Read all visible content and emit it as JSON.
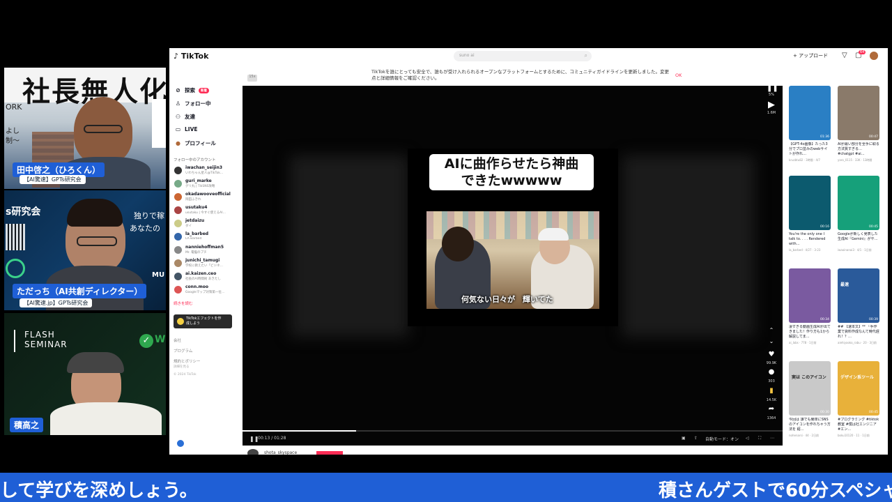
{
  "participants": [
    {
      "name": "田中啓之（ひろくん）",
      "org": "【AI驚速】GPTs研究会",
      "bg_text_big": "社長無人化",
      "bg_text_small_1": "ORK",
      "bg_text_small_2": "よし",
      "bg_text_small_3": "制〜"
    },
    {
      "name": "ただっち（AI共創ディレクター）",
      "org": "【AI驚速.jp】GPTs研究会",
      "bg_text_1": "s研究会",
      "bg_text_2": "独りで稼",
      "bg_text_3": "あなたの",
      "bg_text_4": "MU"
    },
    {
      "name": "積高之",
      "seminar_line1": "FLASH",
      "seminar_line2": "SEMINAR"
    }
  ],
  "tiktok": {
    "logo": "TikTok",
    "search_placeholder": "suno ai",
    "upload_label": "+ アップロード",
    "inbox_badge": "64",
    "notice": "TikTokを誰にとっても安全で、誰もが受け入れられるオープンなプラットフォームとするために、コミュニティガイドラインを更新しました。変更点と詳細情報をご確認ください。",
    "notice_ok": "OK",
    "back_chip": "15x",
    "nav": [
      {
        "label": "探索",
        "badge": "新着",
        "icon": "compass-icon",
        "glyph": "⊘"
      },
      {
        "label": "フォロー中",
        "icon": "follow-icon",
        "glyph": "♙"
      },
      {
        "label": "友達",
        "icon": "friends-icon",
        "glyph": "⚇"
      },
      {
        "label": "LIVE",
        "icon": "live-icon",
        "glyph": "▭"
      },
      {
        "label": "プロフィール",
        "icon": "profile-icon",
        "glyph": "●"
      }
    ],
    "following_title": "フォロー中のアカウント",
    "accounts": [
      {
        "name": "iwachan_seijin3",
        "sub": "いわちゃん星人@TikTok…",
        "color": "#333"
      },
      {
        "name": "guri_marke",
        "sub": "グリ丸 | TikSNS攻略",
        "color": "#7a8"
      },
      {
        "name": "okadawooveofficial",
        "sub": "岡田ふきれ",
        "color": "#c63"
      },
      {
        "name": "usutaku4",
        "sub": "usutaku | 今すぐ使えるAI…",
        "color": "#a44"
      },
      {
        "name": "jetdaizu",
        "sub": "ダイ",
        "color": "#cc8"
      },
      {
        "name": "la_barbed",
        "sub": "LA Barbed",
        "color": "#36a"
      },
      {
        "name": "nanniehoffman5",
        "sub": "Mr. 電脳のプチ",
        "color": "#888"
      },
      {
        "name": "junichi_tamugi",
        "sub": "学校に教えたい「ビジネ…",
        "color": "#a86"
      },
      {
        "name": "ai.kaizen.ceo",
        "sub": "社長のAI時間術 あきたし",
        "color": "#456"
      },
      {
        "name": "conn.moo",
        "sub": "Googleマップ対策第一位…",
        "color": "#d55"
      }
    ],
    "see_more": "続きを読む",
    "effect_label_1": "TikTokエフェクトを作",
    "effect_label_2": "成しよう",
    "footer_1": "会社",
    "footer_2": "プログラム",
    "footer_3": "規約とポリシー",
    "footer_4": "詳細を見る",
    "footer_5": "© 2024 TikTok",
    "video": {
      "caption_line1": "AIに曲作らせたら神曲",
      "caption_line2": "できたwwwww",
      "subtitle": "何気ない日々が　輝いてた",
      "like_count": "99.9K",
      "comment_count": "303",
      "save_count": "14.5K",
      "share_count": "1364",
      "top_percent": "5%",
      "top_views": "1.6M",
      "time": "00:13 / 01:28",
      "progress": 0.21,
      "autoplay_label": "自動モード：オン"
    },
    "creator_name": "shota_skyspace",
    "recommendations": [
      {
        "title": "【GPT-4o画像】たった3分でプロ並みのwebサイトが作れ…",
        "meta": "kruzbtu82 · 3時間 · 4/7",
        "duration": "01:36",
        "color": "#2a7fc4",
        "thumb_text": ""
      },
      {
        "title": "AIが最い部分を全手に取る方法質すぎる… #chatgpt #ai…",
        "meta": "yaro_0115 · 33K · 13時間",
        "duration": "00:47",
        "color": "#8a7a6a",
        "thumb_text": ""
      },
      {
        "title": "You're the only one I talk to. . . . Rendered with…",
        "meta": "la_barbed · 4/27 · 3-23",
        "duration": "00:16",
        "color": "#0c5a6e",
        "thumb_text": ""
      },
      {
        "title": "Googleが新しく発表した生成AI『Gemini』がや…",
        "meta": "iwaoinanai3 · 4/1 · 1日前",
        "duration": "00:45",
        "color": "#16a07a",
        "thumb_text": ""
      },
      {
        "title": "凄すぎる動画生成AIが出てきました！作り方も1から解説してま…",
        "meta": "ai_labs · 778 · 1日前",
        "duration": "00:34",
        "color": "#7a5aa0",
        "thumb_text": ""
      },
      {
        "title": "## 【速本文】** 「手作業で資料作成なんて時代遅れ！？…",
        "meta": "aiehiyaoko_rabu · 20 · 3日前",
        "duration": "00:39",
        "color": "#2a5a9a",
        "thumb_text": "最速"
      },
      {
        "title": "今回は 誰でも簡単にSNSのアイコンを作れちゃう方法を 紹…",
        "meta": "nohenarsi · 44 · 2日前",
        "duration": "00:30",
        "color": "#c9c9c9",
        "thumb_text": "実は このアイコン"
      },
      {
        "title": "#プログラミング #tiktok教室 #僕は社エンジニア #エン…",
        "meta": "boku10120 · 11 · 1日前",
        "duration": "00:45",
        "color": "#e8b13a",
        "thumb_text": "デザイン系ツール"
      }
    ]
  },
  "ticker": {
    "left": "して学びを深めしょう。",
    "right": "積さんゲストで60分スペシャ"
  }
}
